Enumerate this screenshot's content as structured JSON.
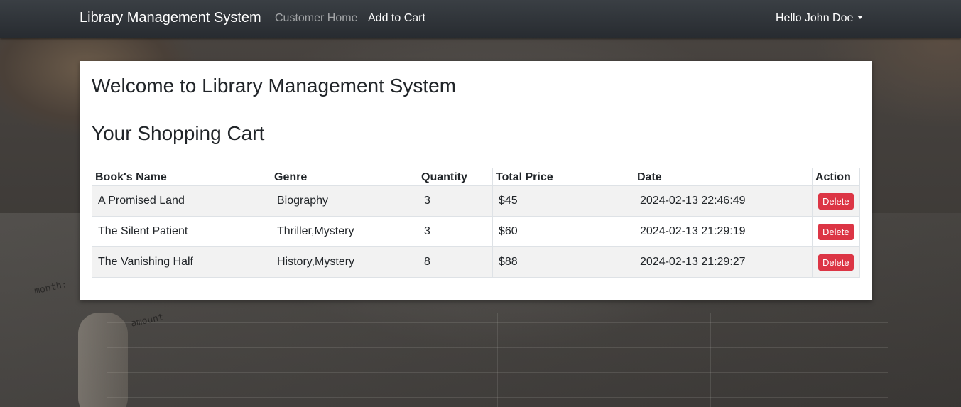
{
  "navbar": {
    "brand": "Library Management System",
    "links": [
      {
        "label": "Customer Home",
        "active": false
      },
      {
        "label": "Add to Cart",
        "active": true
      }
    ],
    "user_menu": "Hello John Doe"
  },
  "background_text": {
    "month": "month:",
    "amount": "amount"
  },
  "main": {
    "welcome_heading": "Welcome to Library Management System",
    "cart_heading": "Your Shopping Cart",
    "table": {
      "headers": [
        "Book's Name",
        "Genre",
        "Quantity",
        "Total Price",
        "Date",
        "Action"
      ],
      "rows": [
        {
          "name": "A Promised Land",
          "genre": "Biography",
          "quantity": "3",
          "total_price": "$45",
          "date": "2024-02-13 22:46:49",
          "action": "Delete"
        },
        {
          "name": "The Silent Patient",
          "genre": "Thriller,Mystery",
          "quantity": "3",
          "total_price": "$60",
          "date": "2024-02-13 21:29:19",
          "action": "Delete"
        },
        {
          "name": "The Vanishing Half",
          "genre": "History,Mystery",
          "quantity": "8",
          "total_price": "$88",
          "date": "2024-02-13 21:29:27",
          "action": "Delete"
        }
      ]
    }
  },
  "colors": {
    "navbar": "#272b30",
    "delete_button": "#dc3545",
    "striped_row": "#f2f2f2"
  }
}
